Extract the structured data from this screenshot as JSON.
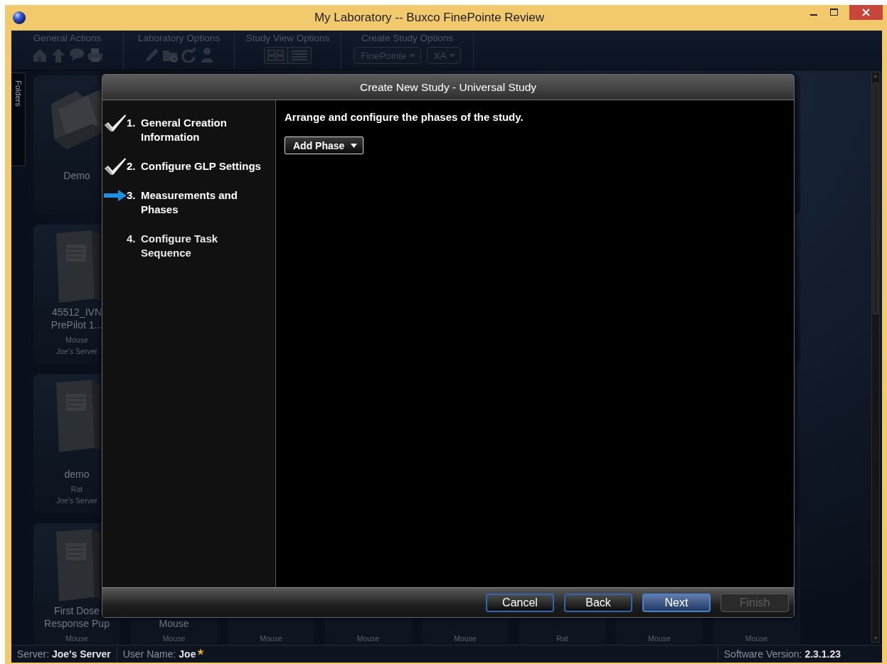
{
  "window": {
    "title": "My Laboratory -- Buxco FinePointe Review"
  },
  "toolbar": {
    "groups": [
      {
        "title": "General Actions",
        "disabled": true
      },
      {
        "title": "Laboratory Options",
        "disabled": true
      },
      {
        "title": "Study View Options",
        "disabled": true
      },
      {
        "title": "Create Study Options",
        "disabled": true,
        "dropdowns": [
          {
            "value": "FinePointe"
          },
          {
            "value": "XA"
          }
        ]
      }
    ]
  },
  "side_tab": {
    "label": "Folders"
  },
  "card_rows": [
    [
      {
        "kind": "folder",
        "title": [
          "Demo"
        ]
      },
      {},
      {},
      {},
      {},
      {},
      {},
      {}
    ],
    [
      {
        "kind": "study",
        "title": [
          "45512_IVN",
          "PrePilot 1..."
        ],
        "species": "Mouse",
        "server": "Joe's Server"
      },
      {},
      {},
      {},
      {},
      {},
      {},
      {}
    ],
    [
      {
        "kind": "study",
        "title": [
          "demo"
        ],
        "species": "Rat",
        "server": "Joe's Server"
      },
      {},
      {},
      {},
      {},
      {},
      {},
      {}
    ],
    [
      {
        "kind": "study",
        "title": [
          "First Dose",
          "Response Pup"
        ],
        "species": "Mouse"
      },
      {
        "title": [
          "Mouse"
        ],
        "species": "Mouse"
      },
      {
        "species": "Mouse"
      },
      {
        "species": "Mouse"
      },
      {
        "species": "Mouse"
      },
      {
        "species": "Rat"
      },
      {
        "species": "Mouse"
      },
      {
        "species": "Mouse"
      }
    ]
  ],
  "dialog": {
    "title": "Create New Study - Universal Study",
    "steps": [
      {
        "number": "1.",
        "label": "General Creation Information",
        "completed": true,
        "selected": false
      },
      {
        "number": "2.",
        "label": "Configure GLP Settings",
        "completed": true,
        "selected": false
      },
      {
        "number": "3.",
        "label": "Measurements and Phases",
        "completed": false,
        "selected": true
      },
      {
        "number": "4.",
        "label": "Configure Task Sequence",
        "completed": false,
        "selected": false
      }
    ],
    "instruction": "Arrange and configure the phases of the study.",
    "add_menu": {
      "label": "Add Phase"
    },
    "buttons": [
      {
        "label": "Cancel",
        "default": false,
        "disabled": false
      },
      {
        "label": "Back",
        "default": false,
        "disabled": false
      },
      {
        "label": "Next",
        "default": true,
        "disabled": false
      },
      {
        "label": "Finish",
        "default": false,
        "disabled": true
      }
    ]
  },
  "status_bar": {
    "server": "Server: **Joe's Server**",
    "user": "User Name: **Joe**",
    "version": "Software Version: **2.3.1.23**"
  }
}
